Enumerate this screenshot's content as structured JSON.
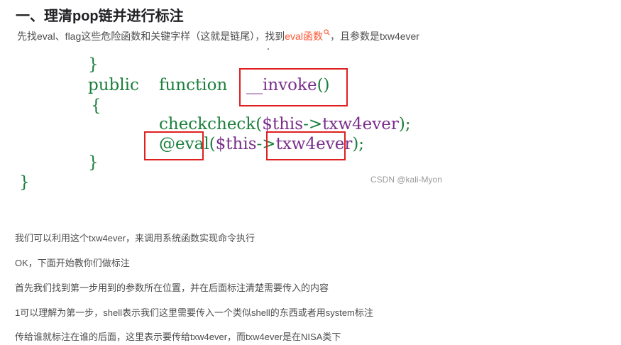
{
  "heading": "一、理清pop链并进行标注",
  "intro": {
    "before": "先找eval、flag这些危险函数和关键字样（这就是链尾），找到",
    "link": "eval函数",
    "search_icon": "search-icon",
    "after": "，且参数是txw4ever"
  },
  "code": {
    "close_brace_1": "}",
    "public": "public",
    "function": "function",
    "invoke": "__invoke",
    "parens": "()",
    "open_brace": "{",
    "checkcheck": "checkcheck",
    "checkcheck_open": "(",
    "this_1": "$this",
    "arrow_1": "->",
    "prop_1": "txw4ever",
    "checkcheck_close": ");",
    "at_eval": "@eval",
    "eval_open": "(",
    "this_2": "$this",
    "arrow_2": "->",
    "prop_2": "txw4ever",
    "eval_close": ");",
    "close_brace_2": "}",
    "close_brace_3": "}"
  },
  "watermark": "CSDN @kali-Myon",
  "paragraphs": [
    "我们可以利用这个txw4ever，来调用系统函数实现命令执行",
    "OK，下面开始教你们做标注",
    "首先我们找到第一步用到的参数所在位置，并在后面标注清楚需要传入的内容",
    "1可以理解为第一步，shell表示我们这里需要传入一个类似shell的东西或者用system标注",
    "传给谁就标注在谁的后面，这里表示要传给txw4ever，而txw4ever是在NISA类下"
  ],
  "colors": {
    "link": "#fc5531",
    "highlight_box": "#e02020",
    "keyword": "#1a7f3c",
    "variable": "#7a2f8c"
  }
}
